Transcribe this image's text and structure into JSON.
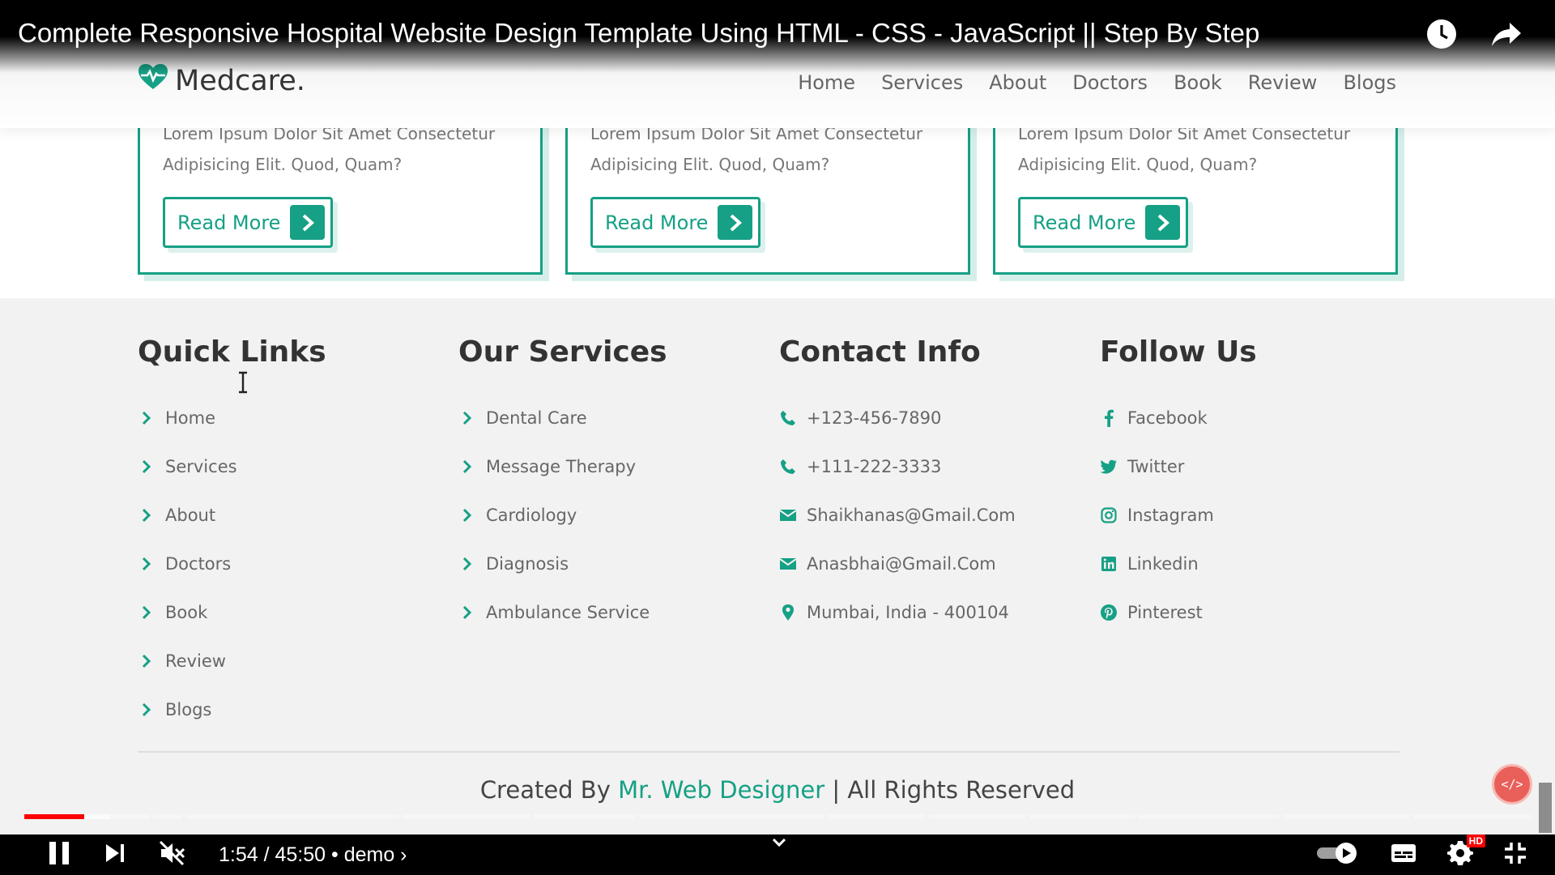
{
  "video": {
    "title": "Complete Responsive Hospital Website Design Template Using HTML - CSS - JavaScript || Step By Step",
    "time": "1:54 / 45:50 • demo ›",
    "progress_played": 0.04,
    "progress_loaded": 0.057,
    "hd_badge": "HD"
  },
  "site": {
    "logo_text": "Medcare.",
    "nav": [
      "Home",
      "Services",
      "About",
      "Doctors",
      "Book",
      "Review",
      "Blogs"
    ],
    "cards": [
      {
        "text": "Lorem Ipsum Dolor Sit Amet Consectetur Adipisicing Elit. Quod, Quam?",
        "button": "Read More"
      },
      {
        "text": "Lorem Ipsum Dolor Sit Amet Consectetur Adipisicing Elit. Quod, Quam?",
        "button": "Read More"
      },
      {
        "text": "Lorem Ipsum Dolor Sit Amet Consectetur Adipisicing Elit. Quod, Quam?",
        "button": "Read More"
      }
    ],
    "footer": {
      "quick_links": {
        "title": "Quick Links",
        "items": [
          "Home",
          "Services",
          "About",
          "Doctors",
          "Book",
          "Review",
          "Blogs"
        ]
      },
      "services": {
        "title": "Our Services",
        "items": [
          "Dental Care",
          "Message Therapy",
          "Cardiology",
          "Diagnosis",
          "Ambulance Service"
        ]
      },
      "contact": {
        "title": "Contact Info",
        "items": [
          {
            "icon": "phone-icon",
            "text": "+123-456-7890"
          },
          {
            "icon": "phone-icon",
            "text": "+111-222-3333"
          },
          {
            "icon": "envelope-icon",
            "text": "Shaikhanas@Gmail.Com"
          },
          {
            "icon": "envelope-icon",
            "text": "Anasbhai@Gmail.Com"
          },
          {
            "icon": "map-marker-icon",
            "text": "Mumbai, India - 400104"
          }
        ]
      },
      "follow": {
        "title": "Follow Us",
        "items": [
          {
            "icon": "facebook-icon",
            "text": "Facebook"
          },
          {
            "icon": "twitter-icon",
            "text": "Twitter"
          },
          {
            "icon": "instagram-icon",
            "text": "Instagram"
          },
          {
            "icon": "linkedin-icon",
            "text": "Linkedin"
          },
          {
            "icon": "pinterest-icon",
            "text": "Pinterest"
          }
        ]
      },
      "credit_prefix": "Created By",
      "credit_name": "Mr. Web Designer",
      "credit_suffix": "| All Rights Reserved"
    },
    "badge_text": "</>"
  },
  "colors": {
    "accent": "#16a085",
    "text": "#666666",
    "heading": "#333333",
    "progress": "#ff0000"
  }
}
